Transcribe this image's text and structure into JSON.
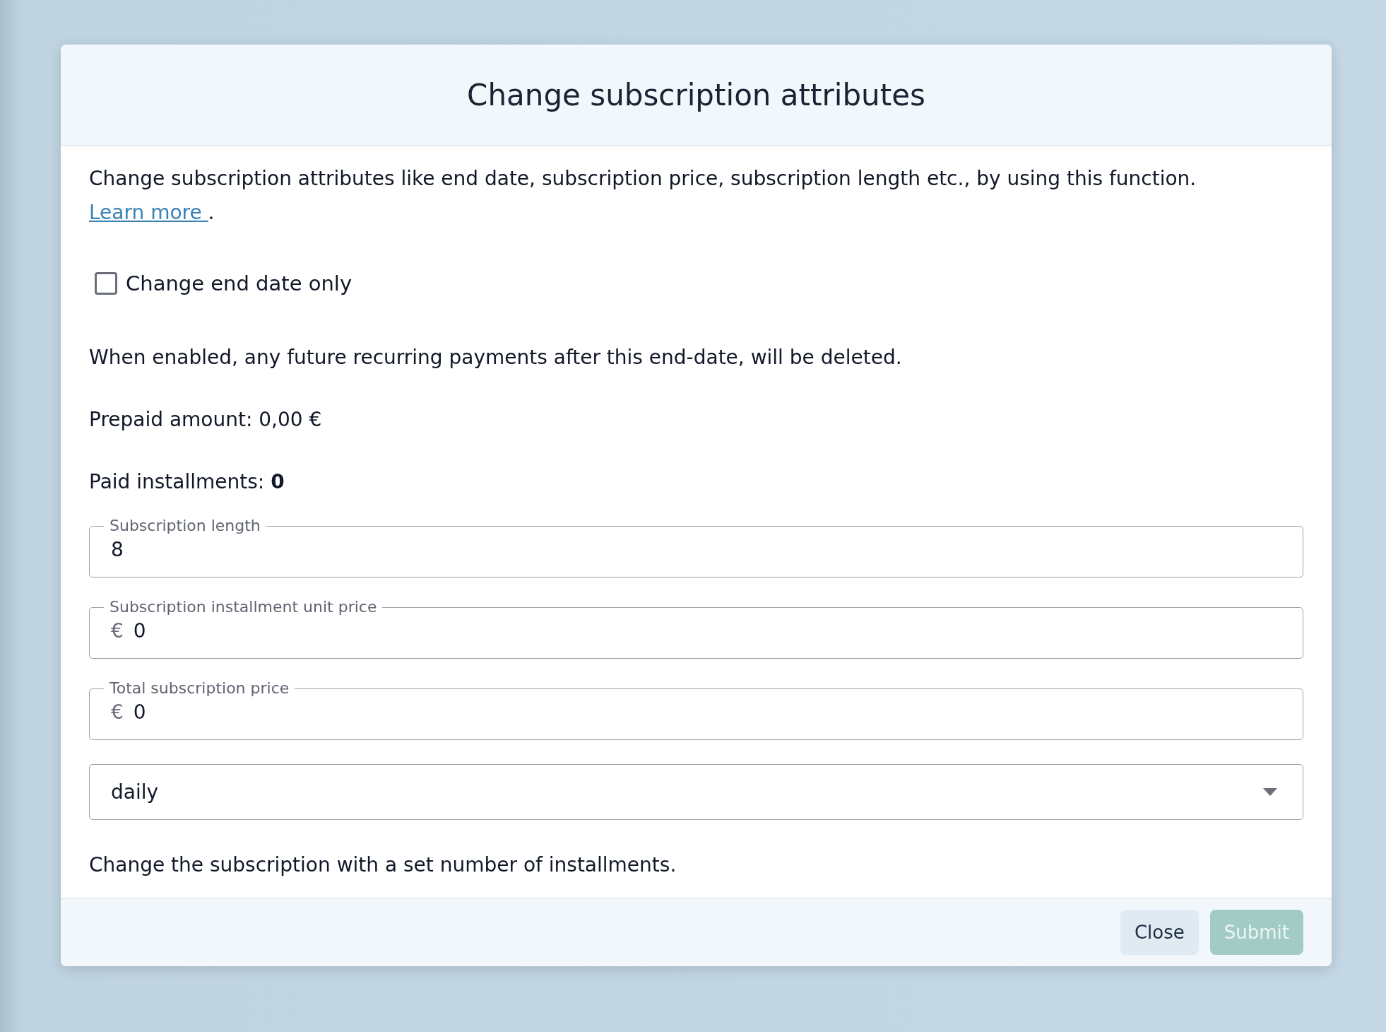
{
  "dialog": {
    "title": "Change subscription attributes",
    "description": "Change subscription attributes like end date, subscription price, subscription length etc., by using this function.",
    "learn_more_link": "Learn more ",
    "description_end": ".",
    "checkbox": {
      "label": "Change end date only",
      "checked": false
    },
    "note": "When enabled, any future recurring payments after this end-date, will be deleted.",
    "prepaid": "Prepaid amount: 0,00 €",
    "paid_installments": "Paid installments: **0**",
    "fields": [
      {
        "kind": "text",
        "label": "Subscription length",
        "value": "8"
      },
      {
        "kind": "text",
        "label": "Subscription installment unit price",
        "prefix": "€",
        "value": "0"
      },
      {
        "kind": "text",
        "label": "Total subscription price",
        "prefix": "€",
        "value": "0"
      },
      {
        "kind": "select",
        "value": "daily"
      }
    ],
    "hint": "Change the subscription with a set number of installments.",
    "buttons": [
      {
        "label": "Close",
        "kind": "secondary",
        "disabled": false
      },
      {
        "label": "Submit",
        "kind": "primary",
        "disabled": true
      }
    ]
  }
}
